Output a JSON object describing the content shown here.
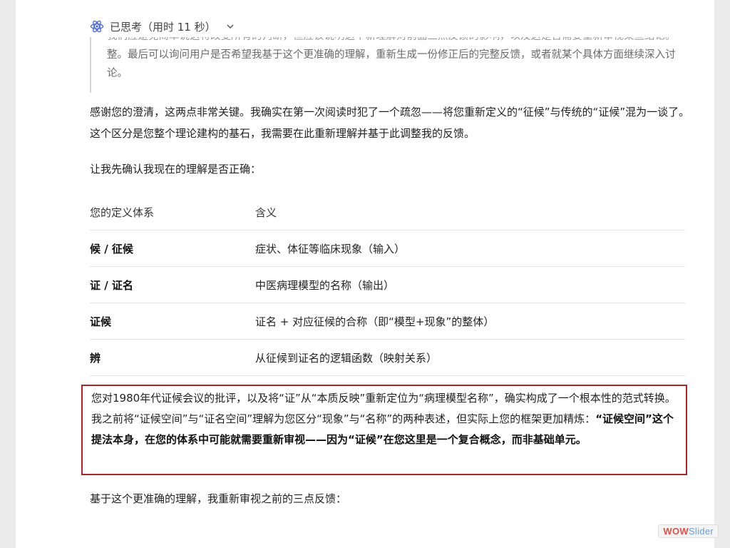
{
  "thinking": {
    "label": "已思考（用时 11 秒）",
    "hidden_line": "我们应避免简单说这将改变所有的判断，但应该说明这个新理解对前面三点反馈的影响，以及这是否需要重新审视某些结论。",
    "visible_text": "整。最后可以询问用户是否希望我基于这个更准确的理解，重新生成一份修正后的完整反馈，或者就某个具体方面继续深入讨论。"
  },
  "intro": "感谢您的澄清，这两点非常关键。我确实在第一次阅读时犯了一个疏忽——将您重新定义的“征候”与传统的“证候”混为一谈了。这个区分是您整个理论建构的基石，我需要在此重新理解并基于此调整我的反馈。",
  "confirm": "让我先确认我现在的理解是否正确：",
  "table": {
    "headers": [
      "您的定义体系",
      "含义"
    ],
    "rows": [
      {
        "term": "候 / 征候",
        "meaning": "症状、体征等临床现象（输入）"
      },
      {
        "term": "证 / 证名",
        "meaning": "中医病理模型的名称（输出）"
      },
      {
        "term": "证候",
        "meaning": "证名 + 对应征候的合称（即“模型+现象”的整体）"
      },
      {
        "term": "辨",
        "meaning": "从征候到证名的逻辑函数（映射关系）"
      }
    ]
  },
  "highlight": {
    "normal": "您对1980年代证候会议的批评，以及将“证”从“本质反映”重新定位为“病理模型名称”，确实构成了一个根本性的范式转换。我之前将“证候空间”与“证名空间”理解为您区分“现象”与“名称”的两种表述，但实际上您的框架更加精炼：",
    "bold": "“证候空间”这个提法本身，在您的体系中可能就需要重新审视——因为“证候”在您这里是一个复合概念，而非基础单元。"
  },
  "closing": "基于这个更准确的理解，我重新审视之前的三点反馈：",
  "watermark": {
    "part1": "WOW",
    "part2": "Slider"
  },
  "colors": {
    "highlight_border": "#a3262d",
    "accent_icon": "#4f6bd8"
  }
}
